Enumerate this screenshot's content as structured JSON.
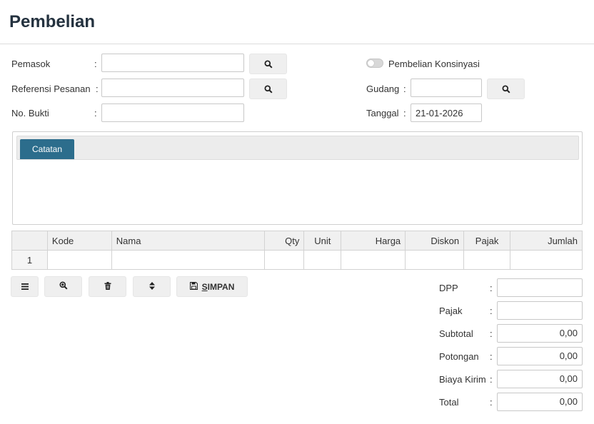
{
  "page": {
    "title": "Pembelian"
  },
  "form": {
    "colon": ":",
    "pemasok": {
      "label": "Pemasok",
      "value": ""
    },
    "referensi": {
      "label": "Referensi Pesanan",
      "value": ""
    },
    "no_bukti": {
      "label": "No. Bukti",
      "value": ""
    },
    "konsinyasi": {
      "label": "Pembelian Konsinyasi",
      "checked": false
    },
    "gudang": {
      "label": "Gudang",
      "value": ""
    },
    "tanggal": {
      "label": "Tanggal",
      "value": "21-01-2026"
    }
  },
  "notes": {
    "tab_label": "Catatan"
  },
  "table": {
    "headers": [
      "",
      "Kode",
      "Nama",
      "Qty",
      "Unit",
      "Harga",
      "Diskon",
      "Pajak",
      "Jumlah"
    ],
    "rows": [
      [
        "1",
        "",
        "",
        "",
        "",
        "",
        "",
        "",
        ""
      ]
    ]
  },
  "toolbar": {
    "save_mnemonic": "S",
    "save_rest": "IMPAN"
  },
  "summary": {
    "dpp": {
      "label": "DPP",
      "value": ""
    },
    "pajak": {
      "label": "Pajak",
      "value": ""
    },
    "subtotal": {
      "label": "Subtotal",
      "value": "0,00"
    },
    "potongan": {
      "label": "Potongan",
      "value": "0,00"
    },
    "biaya_kirim": {
      "label": "Biaya Kirim",
      "value": "0,00"
    },
    "total": {
      "label": "Total",
      "value": "0,00"
    }
  },
  "icons": {
    "search": "search-icon",
    "menu": "menu-icon",
    "zoom": "zoom-in-icon",
    "delete": "trash-icon",
    "sort": "sort-icon",
    "save": "floppy-disk-icon"
  },
  "colors": {
    "tab_active": "#2c6d8c",
    "title": "#24323f"
  }
}
